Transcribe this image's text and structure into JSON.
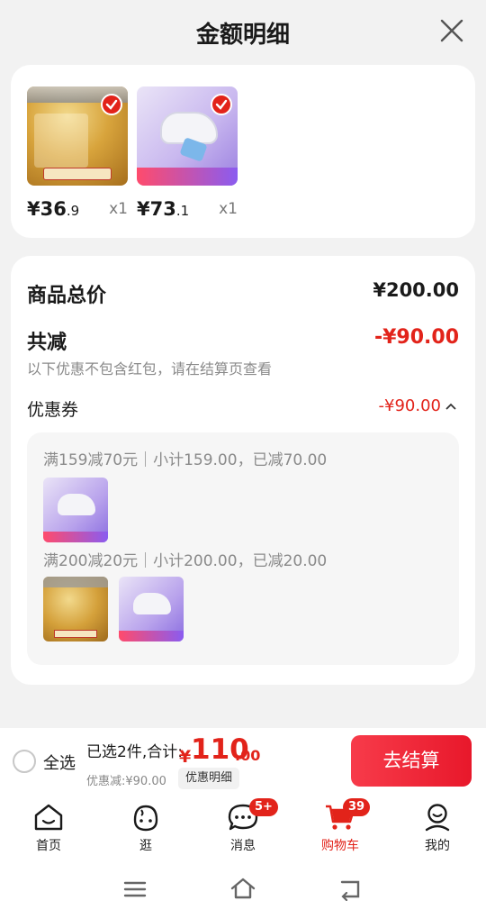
{
  "header": {
    "title": "金额明细"
  },
  "products": [
    {
      "price_int": "¥36",
      "price_dec": ".9",
      "qty": "x1"
    },
    {
      "price_int": "¥73",
      "price_dec": ".1",
      "qty": "x1"
    }
  ],
  "summary": {
    "total_label": "商品总价",
    "total_value": "¥200.00",
    "reduce_label": "共减",
    "reduce_value": "-¥90.00",
    "note": "以下优惠不包含红包，请在结算页查看",
    "coupon_label": "优惠券",
    "coupon_value": "-¥90.00"
  },
  "coupons": [
    {
      "text": "满159减70元｜小计159.00，已减70.00"
    },
    {
      "text": "满200减20元｜小计200.00，已减20.00"
    }
  ],
  "bottom": {
    "select_all": "全选",
    "selected_text": "已选2件,合计:",
    "currency": "¥",
    "total_int": "110",
    "total_dec": ".00",
    "discount": "优惠减:¥90.00",
    "detail_button": "优惠明细",
    "checkout_button": "去结算"
  },
  "tabs": [
    {
      "label": "首页",
      "icon": "home-icon"
    },
    {
      "label": "逛",
      "icon": "face-icon"
    },
    {
      "label": "消息",
      "icon": "message-icon",
      "badge": "5+"
    },
    {
      "label": "购物车",
      "icon": "cart-icon",
      "badge": "39",
      "active": true
    },
    {
      "label": "我的",
      "icon": "profile-icon"
    }
  ],
  "colors": {
    "accent": "#e2231a",
    "checkout": "#f02a3c"
  }
}
